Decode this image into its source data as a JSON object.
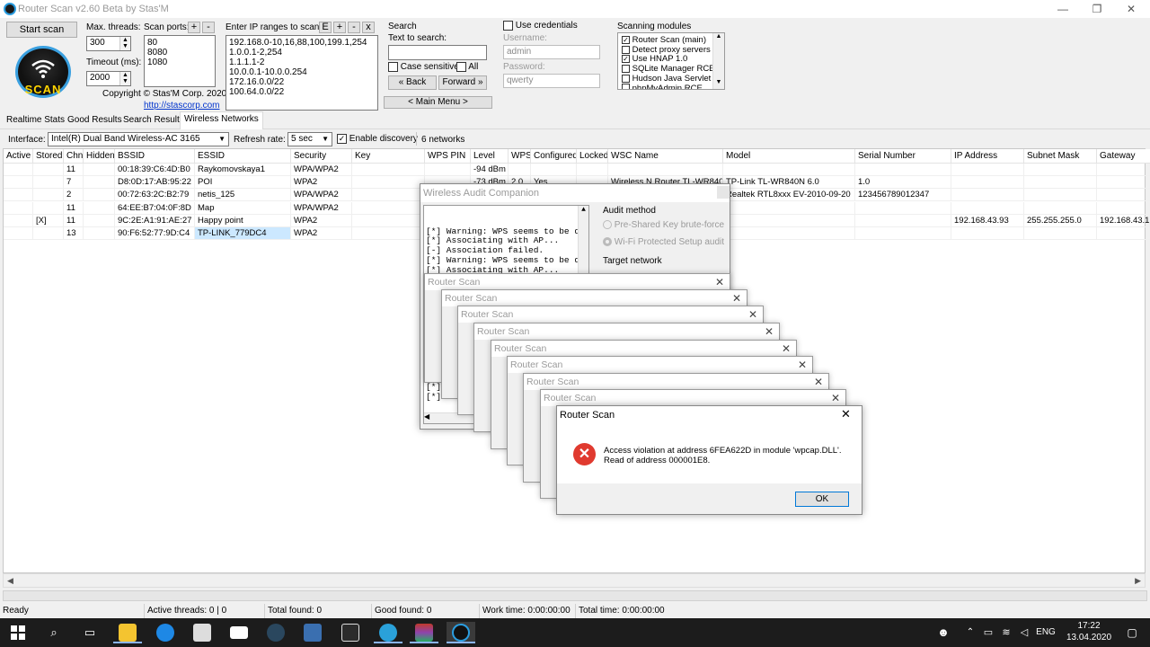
{
  "window": {
    "title": "Router Scan v2.60 Beta by Stas'M",
    "minimize": "—",
    "maximize": "❐",
    "close": "✕"
  },
  "controls": {
    "start_scan": "Start scan",
    "max_threads_label": "Max. threads:",
    "max_threads_value": "300",
    "timeout_label": "Timeout (ms):",
    "timeout_value": "2000",
    "scan_ports_label": "Scan ports:",
    "scan_ports_add": "+",
    "scan_ports_remove": "-",
    "scan_ports": "80\n8080\n1080",
    "copyright": "Copyright © Stas'M Corp. 2020",
    "website": "http://stascorp.com",
    "logo_text": "SCAN"
  },
  "ip_ranges": {
    "label": "Enter IP ranges to scan:",
    "btn_e": "E",
    "btn_add": "+",
    "btn_remove": "-",
    "btn_clear": "x",
    "text": "192.168.0-10,16,88,100,199.1,254\n1.0.0.1-2,254\n1.1.1.1-2\n10.0.0.1-10.0.0.254\n172.16.0.0/22\n100.64.0.0/22"
  },
  "search": {
    "group_label": "Search",
    "text_label": "Text to search:",
    "value": "",
    "case_sensitive": "Case sensitive",
    "all": "All",
    "back": "« Back",
    "forward": "Forward »",
    "main_menu": "< Main Menu >"
  },
  "credentials": {
    "use_credentials": "Use credentials",
    "username_label": "Username:",
    "username": "admin",
    "password_label": "Password:",
    "password": "qwerty"
  },
  "modules": {
    "label": "Scanning modules",
    "items": [
      {
        "label": "Router Scan (main)",
        "checked": "✓"
      },
      {
        "label": "Detect proxy servers",
        "checked": ""
      },
      {
        "label": "Use HNAP 1.0",
        "checked": "✓"
      },
      {
        "label": "SQLite Manager RCE",
        "checked": ""
      },
      {
        "label": "Hudson Java Servlet",
        "checked": ""
      },
      {
        "label": "phpMyAdmin RCE",
        "checked": ""
      }
    ]
  },
  "tabs": [
    {
      "label": "Realtime Stats"
    },
    {
      "label": "Good Results"
    },
    {
      "label": "Search Results"
    },
    {
      "label": "Wireless Networks"
    }
  ],
  "wireless_bar": {
    "interface_label": "Interface:",
    "interface_value": "Intel(R) Dual Band Wireless-AC 3165",
    "refresh_label": "Refresh rate:",
    "refresh_value": "5 sec",
    "enable_discovery": "Enable discovery",
    "network_count": "6 networks"
  },
  "table": {
    "columns": [
      "Active",
      "Stored",
      "Chn",
      "Hidden",
      "BSSID",
      "ESSID",
      "Security",
      "Key",
      "WPS PIN",
      "Level",
      "WPS",
      "Configured",
      "Locked",
      "WSC Name",
      "Model",
      "Serial Number",
      "IP Address",
      "Subnet Mask",
      "Gateway"
    ],
    "rows": [
      [
        "",
        "",
        "11",
        "",
        "00:18:39:C6:4D:B0",
        "Raykomovskaya1",
        "WPA/WPA2",
        "",
        "",
        "-94 dBm",
        "",
        "",
        "",
        "",
        "",
        "",
        "",
        "",
        ""
      ],
      [
        "",
        "",
        "7",
        "",
        "D8:0D:17:AB:95:22",
        "POI",
        "WPA2",
        "",
        "",
        "-73 dBm",
        "2.0",
        "Yes",
        "",
        "Wireless N Router TL-WR840N",
        "TP-Link TL-WR840N 6.0",
        "1.0",
        "",
        "",
        ""
      ],
      [
        "",
        "",
        "2",
        "",
        "00:72:63:2C:B2:79",
        "netis_125",
        "WPA/WPA2",
        "",
        "",
        "",
        "",
        "",
        "",
        "",
        "Realtek RTL8xxx EV-2010-09-20",
        "123456789012347",
        "",
        "",
        ""
      ],
      [
        "",
        "",
        "11",
        "",
        "64:EE:B7:04:0F:8D",
        "Map",
        "WPA/WPA2",
        "",
        "",
        "",
        "",
        "",
        "",
        "",
        "",
        "",
        "",
        "",
        ""
      ],
      [
        "",
        "[X]",
        "11",
        "",
        "9C:2E:A1:91:AE:27",
        "Happy point",
        "WPA2",
        "",
        "",
        "",
        "",
        "",
        "",
        "",
        "",
        "",
        "192.168.43.93",
        "255.255.255.0",
        "192.168.43.1"
      ],
      [
        "",
        "",
        "13",
        "",
        "90:F6:52:77:9D:C4",
        "TP-LINK_779DC4",
        "WPA2",
        "",
        "",
        "",
        "",
        "",
        "",
        "",
        "",
        "",
        "",
        "",
        ""
      ]
    ]
  },
  "status": {
    "ready": "Ready",
    "active_threads": "Active threads: 0 | 0",
    "total_found": "Total found: 0",
    "good_found": "Good found: 0",
    "work_time": "Work time: 0:00:00:00",
    "total_time": "Total time: 0:00:00:00"
  },
  "audit": {
    "title": "Wireless Audit Companion",
    "log": "[*] Warning: WPS seems to be disal\n[*] Associating with AP...\n[-] Association failed.\n[*] Warning: WPS seems to be disal\n[*] Associating with AP...\n[-] Association failed.\n[*] Warning: WPS seems to be disal",
    "log_tail": "[*]\n[*]",
    "audit_method": "Audit method",
    "psk": "Pre-Shared Key brute-force",
    "wps": "Wi-Fi Protected Setup audit",
    "target": "Target network"
  },
  "error_dialog": {
    "stack_title": "Router Scan",
    "title": "Router Scan",
    "close": "✕",
    "message_line1": "Access violation at address 6FEA622D in module 'wpcap.DLL'.",
    "message_line2": "Read of address 000001E8.",
    "ok": "OK"
  },
  "taskbar": {
    "time": "17:22",
    "date": "13.04.2020",
    "lang": "ENG"
  }
}
